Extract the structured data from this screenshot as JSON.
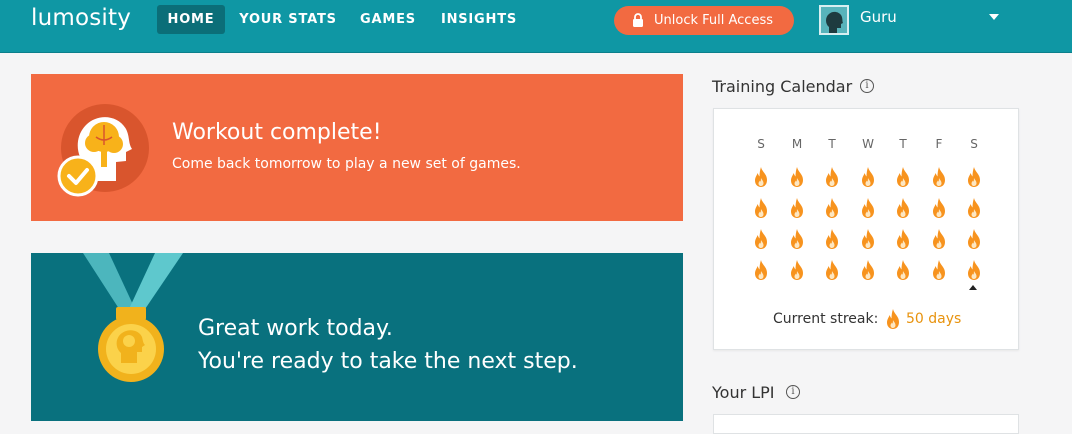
{
  "nav": {
    "logo": "lumosity",
    "items": [
      {
        "label": "HOME",
        "active": true
      },
      {
        "label": "YOUR STATS",
        "active": false
      },
      {
        "label": "GAMES",
        "active": false
      },
      {
        "label": "INSIGHTS",
        "active": false
      }
    ],
    "unlock_label": "Unlock Full Access",
    "username": "Guru"
  },
  "workout": {
    "title": "Workout complete!",
    "subtitle": "Come back tomorrow to play a new set of games."
  },
  "great_work": {
    "line1": "Great work today.",
    "line2": "You're ready to take the next step."
  },
  "calendar": {
    "title": "Training Calendar",
    "days": [
      "S",
      "M",
      "T",
      "W",
      "T",
      "F",
      "S"
    ],
    "weeks_completed": 4,
    "streak_label": "Current streak:",
    "streak_value": "50 days"
  },
  "lpi": {
    "title": "Your LPI"
  },
  "colors": {
    "nav_bg": "#0f97a4",
    "accent_orange": "#f26a41",
    "teal_dark": "#09717e",
    "flame_orange": "#f7931e",
    "streak_text": "#e8930e"
  }
}
